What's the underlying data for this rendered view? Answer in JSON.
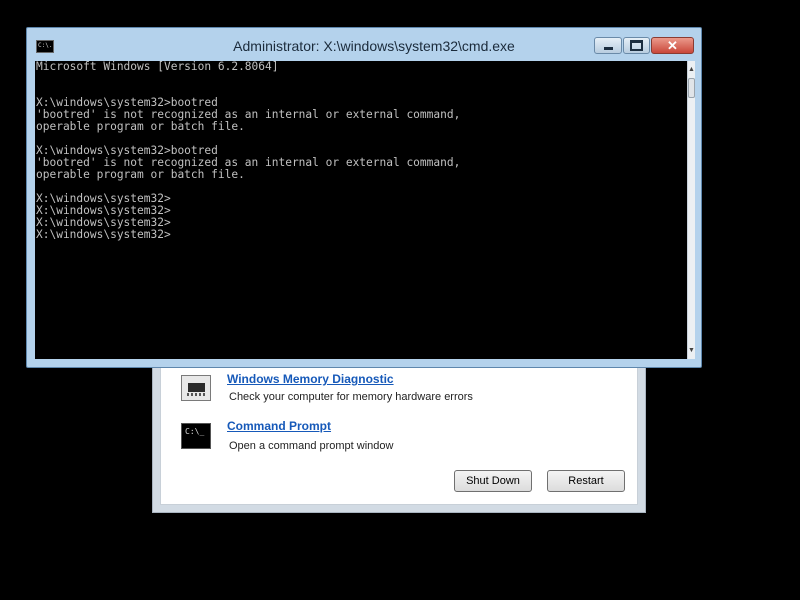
{
  "cmd_window": {
    "title": "Administrator: X:\\windows\\system32\\cmd.exe",
    "icon_label": "C:\\.",
    "controls": {
      "close_label": "✕"
    },
    "console_lines": [
      "Microsoft Windows [Version 6.2.8064]",
      "",
      "",
      "X:\\windows\\system32>bootred",
      "'bootred' is not recognized as an internal or external command,",
      "operable program or batch file.",
      "",
      "X:\\windows\\system32>bootred",
      "'bootred' is not recognized as an internal or external command,",
      "operable program or batch file.",
      "",
      "X:\\windows\\system32>",
      "X:\\windows\\system32>",
      "X:\\windows\\system32>",
      "X:\\windows\\system32>"
    ],
    "scroll": {
      "up_arrow": "▲",
      "down_arrow": "▼"
    }
  },
  "recovery_panel": {
    "tools": {
      "memory_diagnostic": {
        "label": "Windows Memory Diagnostic",
        "description": "Check your computer for memory hardware errors"
      },
      "command_prompt": {
        "label": "Command Prompt",
        "description": "Open a command prompt window",
        "icon_label": "C:\\_"
      }
    },
    "buttons": {
      "shut_down": "Shut Down",
      "restart": "Restart"
    }
  },
  "colors": {
    "desktop_background": "#000000",
    "console_background": "#000000",
    "console_text": "#c0c0c0",
    "window_frame": "#b4d2ec",
    "link": "#1659b9",
    "close_button": "#c9473a"
  }
}
